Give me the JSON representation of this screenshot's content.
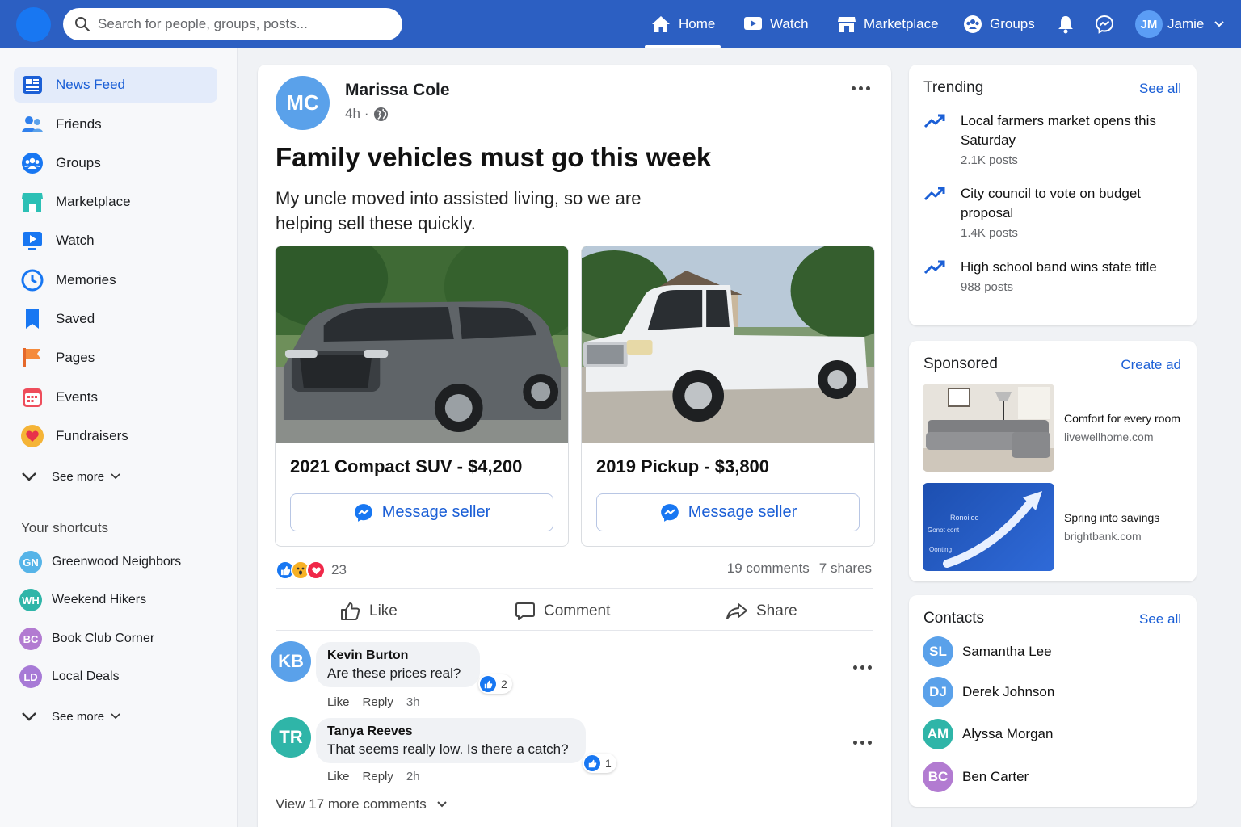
{
  "topbar": {
    "search_placeholder": "Search for people, groups, posts...",
    "nav": [
      {
        "label": "Home",
        "icon": "home-icon",
        "active": true
      },
      {
        "label": "Watch",
        "icon": "watch-icon"
      },
      {
        "label": "Marketplace",
        "icon": "marketplace-icon"
      },
      {
        "label": "Groups",
        "icon": "groups-icon"
      }
    ],
    "profile": {
      "initials": "JM",
      "name": "Jamie"
    },
    "colors": {
      "bar": "#2c5fc2",
      "accent": "#1877f2"
    }
  },
  "sidebar": {
    "items": [
      {
        "label": "News Feed",
        "icon": "news-feed-icon",
        "active": true
      },
      {
        "label": "Friends",
        "icon": "friends-icon"
      },
      {
        "label": "Groups",
        "icon": "groups-icon"
      },
      {
        "label": "Marketplace",
        "icon": "marketplace-icon"
      },
      {
        "label": "Watch",
        "icon": "watch-icon"
      },
      {
        "label": "Memories",
        "icon": "clock-icon"
      },
      {
        "label": "Saved",
        "icon": "bookmark-icon"
      },
      {
        "label": "Pages",
        "icon": "flag-icon"
      },
      {
        "label": "Events",
        "icon": "calendar-icon"
      },
      {
        "label": "Fundraisers",
        "icon": "heart-icon"
      }
    ],
    "see_more": "See more",
    "shortcuts_title": "Your shortcuts",
    "shortcuts": [
      {
        "initials": "GN",
        "label": "Greenwood Neighbors",
        "color": "#56b4e8"
      },
      {
        "initials": "WH",
        "label": "Weekend Hikers",
        "color": "#2fb5a8"
      },
      {
        "initials": "BC",
        "label": "Book Club Corner",
        "color": "#b27bd1"
      },
      {
        "initials": "LD",
        "label": "Local Deals",
        "color": "#a77ad6"
      }
    ],
    "see_more_2": "See more"
  },
  "post": {
    "author_initials": "MC",
    "author": "Marissa Cole",
    "time": "4h",
    "title": "Family vehicles must go this week",
    "body": "My uncle moved into assisted living, so we are helping sell these quickly.",
    "listings": [
      {
        "title": "2021 Compact SUV - $4,200",
        "button": "Message seller"
      },
      {
        "title": "2019 Pickup - $3,800",
        "button": "Message seller"
      }
    ],
    "reaction_count": "23",
    "comments_count": "19 comments",
    "shares_count": "7 shares",
    "actions": {
      "like": "Like",
      "comment": "Comment",
      "share": "Share"
    },
    "comments": [
      {
        "initials": "KB",
        "name": "Kevin Burton",
        "text": "Are these prices real?",
        "likes": "2",
        "like": "Like",
        "reply": "Reply",
        "time": "3h",
        "color": "#5aa1ea"
      },
      {
        "initials": "TR",
        "name": "Tanya Reeves",
        "text": "That seems really low. Is there a catch?",
        "likes": "1",
        "like": "Like",
        "reply": "Reply",
        "time": "2h",
        "color": "#2fb5a8"
      }
    ],
    "view_more": "View 17 more comments"
  },
  "trending": {
    "title": "Trending",
    "see_all": "See all",
    "items": [
      {
        "text": "Local farmers market opens this Saturday",
        "count": "2.1K posts"
      },
      {
        "text": "City council to vote on budget proposal",
        "count": "1.4K posts"
      },
      {
        "text": "High school band wins state title",
        "count": "988 posts"
      }
    ]
  },
  "sponsored": {
    "title": "Sponsored",
    "create_ad": "Create ad",
    "ads": [
      {
        "title": "Comfort for every room",
        "url": "livewellhome.com"
      },
      {
        "title": "Spring into savings",
        "url": "brightbank.com",
        "image_text_1": "Ronoiioo",
        "image_text_2": "Gonot cont",
        "image_text_3": "Oonting"
      }
    ]
  },
  "contacts": {
    "title": "Contacts",
    "see_all": "See all",
    "items": [
      {
        "initials": "SL",
        "name": "Samantha Lee",
        "color": "#5aa1ea"
      },
      {
        "initials": "DJ",
        "name": "Derek Johnson",
        "color": "#5aa1ea"
      },
      {
        "initials": "AM",
        "name": "Alyssa Morgan",
        "color": "#2fb5a8"
      },
      {
        "initials": "BC",
        "name": "Ben Carter",
        "color": "#b27bd1"
      }
    ]
  }
}
